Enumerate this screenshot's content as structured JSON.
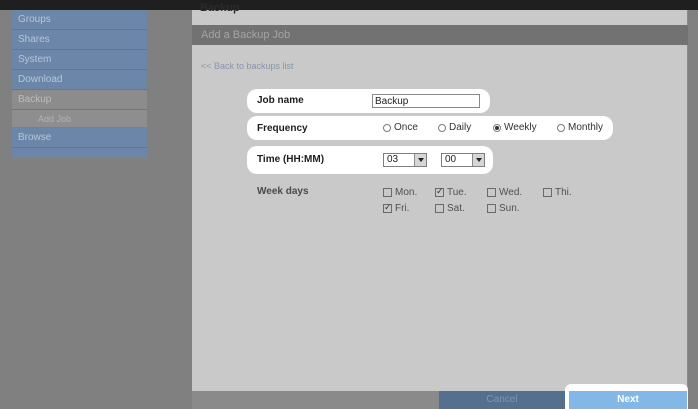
{
  "page": {
    "heading": "Backup"
  },
  "sidebar": {
    "items": [
      {
        "label": "Groups"
      },
      {
        "label": "Shares"
      },
      {
        "label": "System"
      },
      {
        "label": "Download"
      },
      {
        "label": "Backup"
      },
      {
        "label": "Add Job"
      },
      {
        "label": "Browse"
      }
    ]
  },
  "section": {
    "title": "Add a Backup Job"
  },
  "back_link": "<< Back to backups list",
  "form": {
    "job_name": {
      "label": "Job name",
      "value": "Backup"
    },
    "frequency": {
      "label": "Frequency",
      "options": [
        "Once",
        "Daily",
        "Weekly",
        "Monthly"
      ],
      "selected": "Weekly"
    },
    "time": {
      "label": "Time (HH:MM)",
      "hour": "03",
      "minute": "00"
    },
    "week_days": {
      "label": "Week days",
      "days": [
        {
          "label": "Mon.",
          "checked": false
        },
        {
          "label": "Tue.",
          "checked": true
        },
        {
          "label": "Wed.",
          "checked": false
        },
        {
          "label": "Thi.",
          "checked": false
        },
        {
          "label": "Fri.",
          "checked": true
        },
        {
          "label": "Sat.",
          "checked": false
        },
        {
          "label": "Sun.",
          "checked": false
        }
      ]
    }
  },
  "footer": {
    "cancel_label": "Cancel",
    "next_label": "Next"
  }
}
